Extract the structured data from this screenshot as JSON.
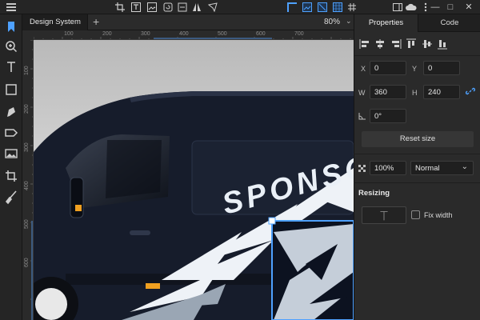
{
  "toolbar": {
    "menu_icon": "hamburger-icon",
    "tools_center": [
      "crop-icon",
      "text-frame-icon",
      "image-frame-icon",
      "rotate-icon",
      "flip-icon",
      "flip-horizontal-icon",
      "send-icon"
    ],
    "tools_right": [
      "corner-icon",
      "image-icon",
      "guides-icon",
      "grid-icon",
      "cloud-icon",
      "menu-dots-icon"
    ],
    "window_buttons": [
      "—",
      "□",
      "✕"
    ],
    "accent_color": "#4ea1ff"
  },
  "left_tools": [
    "pointer-icon",
    "zoom-icon",
    "text-icon",
    "rectangle-icon",
    "pen-icon",
    "shape-icon",
    "image-icon",
    "crop-icon",
    "knife-icon"
  ],
  "document": {
    "tab_label": "Design System",
    "tab_close": "×",
    "add_tab": "+",
    "zoom_value": "80%",
    "zoom_chevron": "⌄"
  },
  "rulers": {
    "horizontal": [
      "100",
      "200",
      "300",
      "400",
      "500",
      "600",
      "700"
    ],
    "vertical": [
      "100",
      "200",
      "300",
      "400",
      "500",
      "600"
    ]
  },
  "canvas": {
    "van_text": "SPONSO",
    "background_color": "#d7d7d7",
    "van_color": "#161c2b"
  },
  "panel": {
    "tabs": [
      "Properties",
      "Code"
    ],
    "active_tab": "Properties",
    "x_label": "X",
    "x_value": "0",
    "y_label": "Y",
    "y_value": "0",
    "w_label": "W",
    "w_value": "360",
    "h_label": "H",
    "h_value": "240",
    "link_icon": "link-icon",
    "rotation_value": "0°",
    "reset_size_label": "Reset size",
    "opacity_value": "100%",
    "blend_mode": "Normal",
    "blend_chevron": "⌄",
    "resizing_title": "Resizing",
    "fix_width_label": "Fix width"
  }
}
